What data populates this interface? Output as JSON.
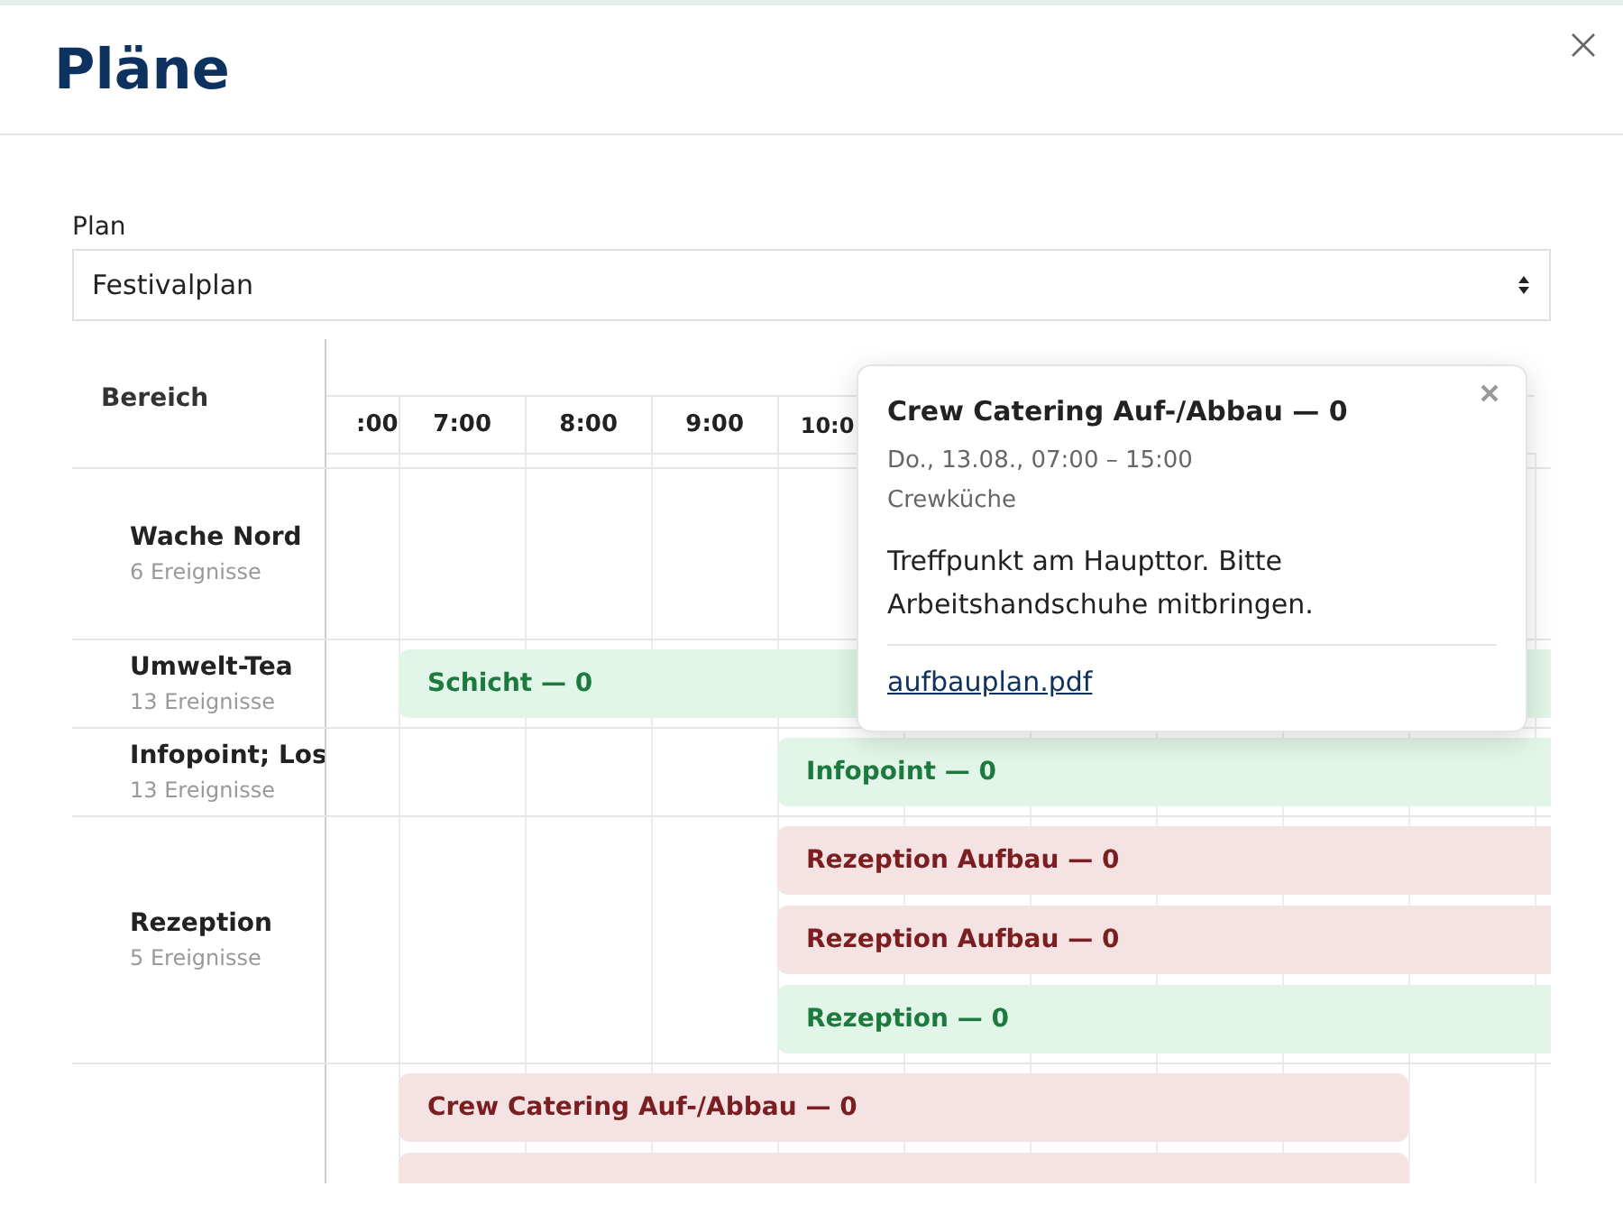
{
  "window": {
    "title": "Pläne"
  },
  "plan": {
    "label": "Plan",
    "value": "Festivalplan"
  },
  "schedule": {
    "area_heading": "Bereich",
    "hours": [
      ":00",
      "7:00",
      "8:00",
      "9:00",
      "10:0"
    ],
    "rows": [
      {
        "name": "Wache Nord",
        "count": "6 Ereignisse",
        "events": []
      },
      {
        "name": "Umwelt-Tea",
        "count": "13 Ereignisse",
        "events": [
          {
            "title": "Schicht — 0",
            "color": "#e1f5e8"
          }
        ]
      },
      {
        "name": "Infopoint; Los",
        "count": "13 Ereignisse",
        "events": [
          {
            "title": "Infopoint — 0",
            "color": "#e1f5e8"
          }
        ]
      },
      {
        "name": "Rezeption",
        "count": "5 Ereignisse",
        "events": [
          {
            "title": "Rezeption Aufbau — 0",
            "color": "#f5e2e2"
          },
          {
            "title": "Rezeption Aufbau — 0",
            "color": "#f5e2e2"
          },
          {
            "title": "Rezeption — 0",
            "color": "#e1f5e8"
          }
        ]
      },
      {
        "events": [
          {
            "title": "Crew Catering Auf-/Abbau — 0",
            "color": "#f5e2e2"
          },
          {
            "color": "#f5e2e2"
          }
        ]
      }
    ]
  },
  "popup": {
    "title": "Crew Catering Auf-/Abbau — 0",
    "time": "Do., 13.08., 07:00 – 15:00",
    "location": "Crewküche",
    "description": "Treffpunkt am Haupttor. Bitte Arbeitshandschuhe mitbringen.",
    "attachment": "aufbauplan.pdf"
  }
}
